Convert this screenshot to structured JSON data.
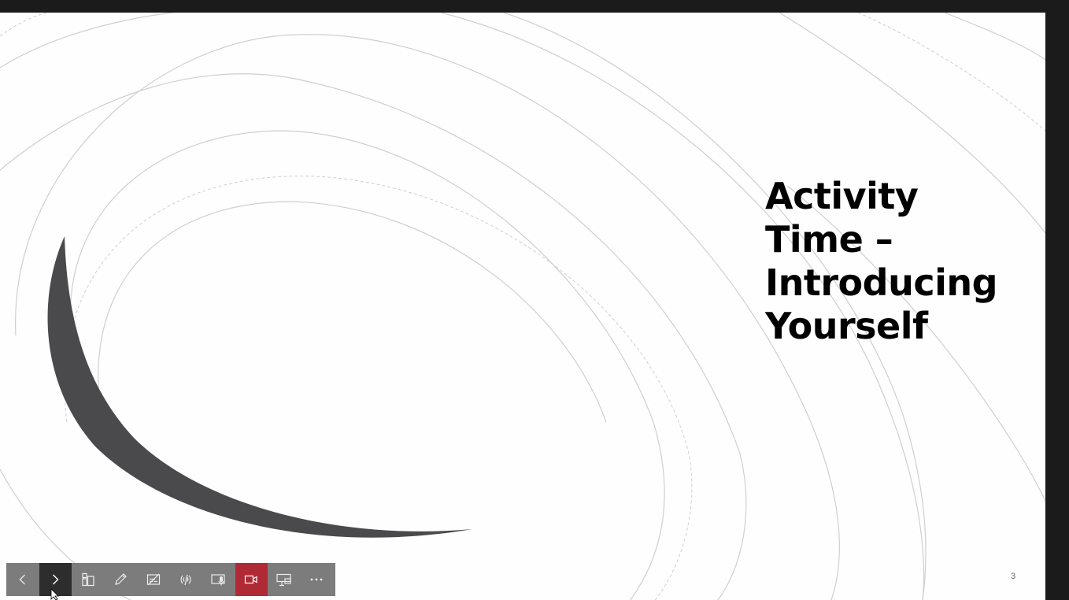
{
  "slide": {
    "title_lines": [
      "Activity",
      "Time –",
      "Introducing",
      "Yourself"
    ],
    "number": "3"
  },
  "toolbar": {
    "buttons": [
      {
        "name": "previous-slide",
        "icon": "chevron-left-icon"
      },
      {
        "name": "next-slide",
        "icon": "chevron-right-icon"
      },
      {
        "name": "see-all-slides",
        "icon": "slides-grid-icon"
      },
      {
        "name": "pen-tool",
        "icon": "pen-icon"
      },
      {
        "name": "subtitles",
        "icon": "subtitles-off-icon"
      },
      {
        "name": "live-broadcast",
        "icon": "broadcast-icon"
      },
      {
        "name": "microphone",
        "icon": "mic-icon"
      },
      {
        "name": "camera",
        "icon": "video-camera-icon"
      },
      {
        "name": "presenter-view",
        "icon": "presenter-icon"
      },
      {
        "name": "more-options",
        "icon": "more-icon"
      }
    ]
  },
  "colors": {
    "frame": "#1b1b1b",
    "slide_background": "#fefefe",
    "swoosh": "#4a4a4d",
    "toolbar": "#7c7c7c",
    "toolbar_active": "#2d2d2d",
    "record_button": "#b02a35"
  }
}
